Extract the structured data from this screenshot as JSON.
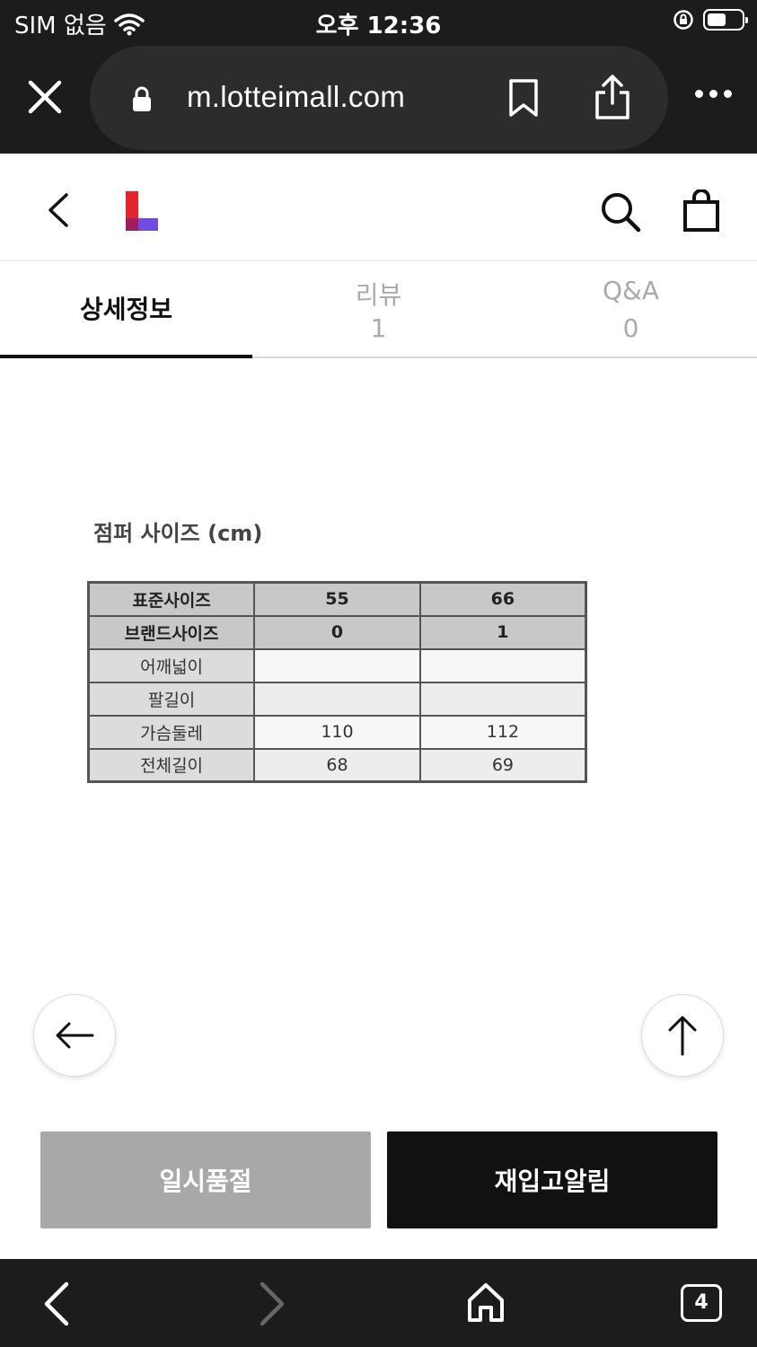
{
  "status": {
    "carrier": "SIM 없음",
    "time": "오후 12:36"
  },
  "browser": {
    "url": "m.lotteimall.com",
    "tab_count": "4"
  },
  "tabs": [
    {
      "label": "상세정보",
      "active": true
    },
    {
      "label": "리뷰",
      "count": "1"
    },
    {
      "label": "Q&A",
      "count": "0"
    }
  ],
  "size_chart": {
    "title": "점퍼 사이즈 (cm)",
    "rows": [
      [
        "표준사이즈",
        "55",
        "66"
      ],
      [
        "브랜드사이즈",
        "0",
        "1"
      ],
      [
        "어깨넓이",
        "",
        ""
      ],
      [
        "팔길이",
        "",
        ""
      ],
      [
        "가슴둘레",
        "110",
        "112"
      ],
      [
        "전체길이",
        "68",
        "69"
      ]
    ]
  },
  "actions": {
    "soldout_label": "일시품절",
    "restock_label": "재입고알림"
  },
  "colors": {
    "logo_red": "#e5242c",
    "logo_purple": "#6f4ce6",
    "chrome_bg": "#1c1c1e"
  }
}
